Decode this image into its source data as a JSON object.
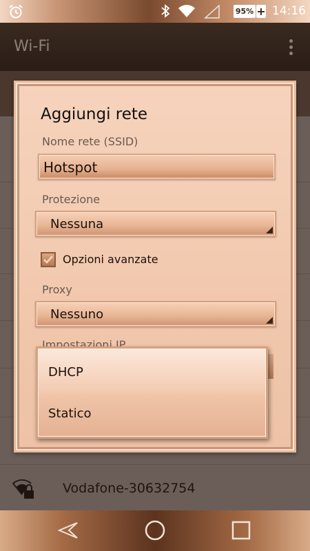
{
  "status_bar": {
    "battery_text": "95%",
    "battery_charging_symbol": "+",
    "time": "14:16",
    "icons": [
      "alarm-icon",
      "bluetooth-icon",
      "wifi-icon",
      "signal-icon",
      "battery-icon"
    ]
  },
  "action_bar": {
    "title": "Wi-Fi",
    "menu_icon": "overflow-menu-icon"
  },
  "dialog": {
    "title": "Aggiungi rete",
    "ssid_label": "Nome rete (SSID)",
    "ssid_value": "Hotspot",
    "security_label": "Protezione",
    "security_value": "Nessuna",
    "advanced_label": "Opzioni avanzate",
    "advanced_checked": true,
    "proxy_label": "Proxy",
    "proxy_value": "Nessuno",
    "ip_settings_label": "Impostazioni IP"
  },
  "popup": {
    "options": [
      "DHCP",
      "Statico"
    ]
  },
  "network_list": {
    "visible_network": "Vodafone-30632754"
  },
  "navigation_bar": {
    "icons": [
      "back-icon",
      "home-icon",
      "recents-icon"
    ]
  },
  "colors": {
    "accent": "#b27853",
    "dialog_bg": "#f4cdb5",
    "dim_bg": "#6b5e58"
  }
}
